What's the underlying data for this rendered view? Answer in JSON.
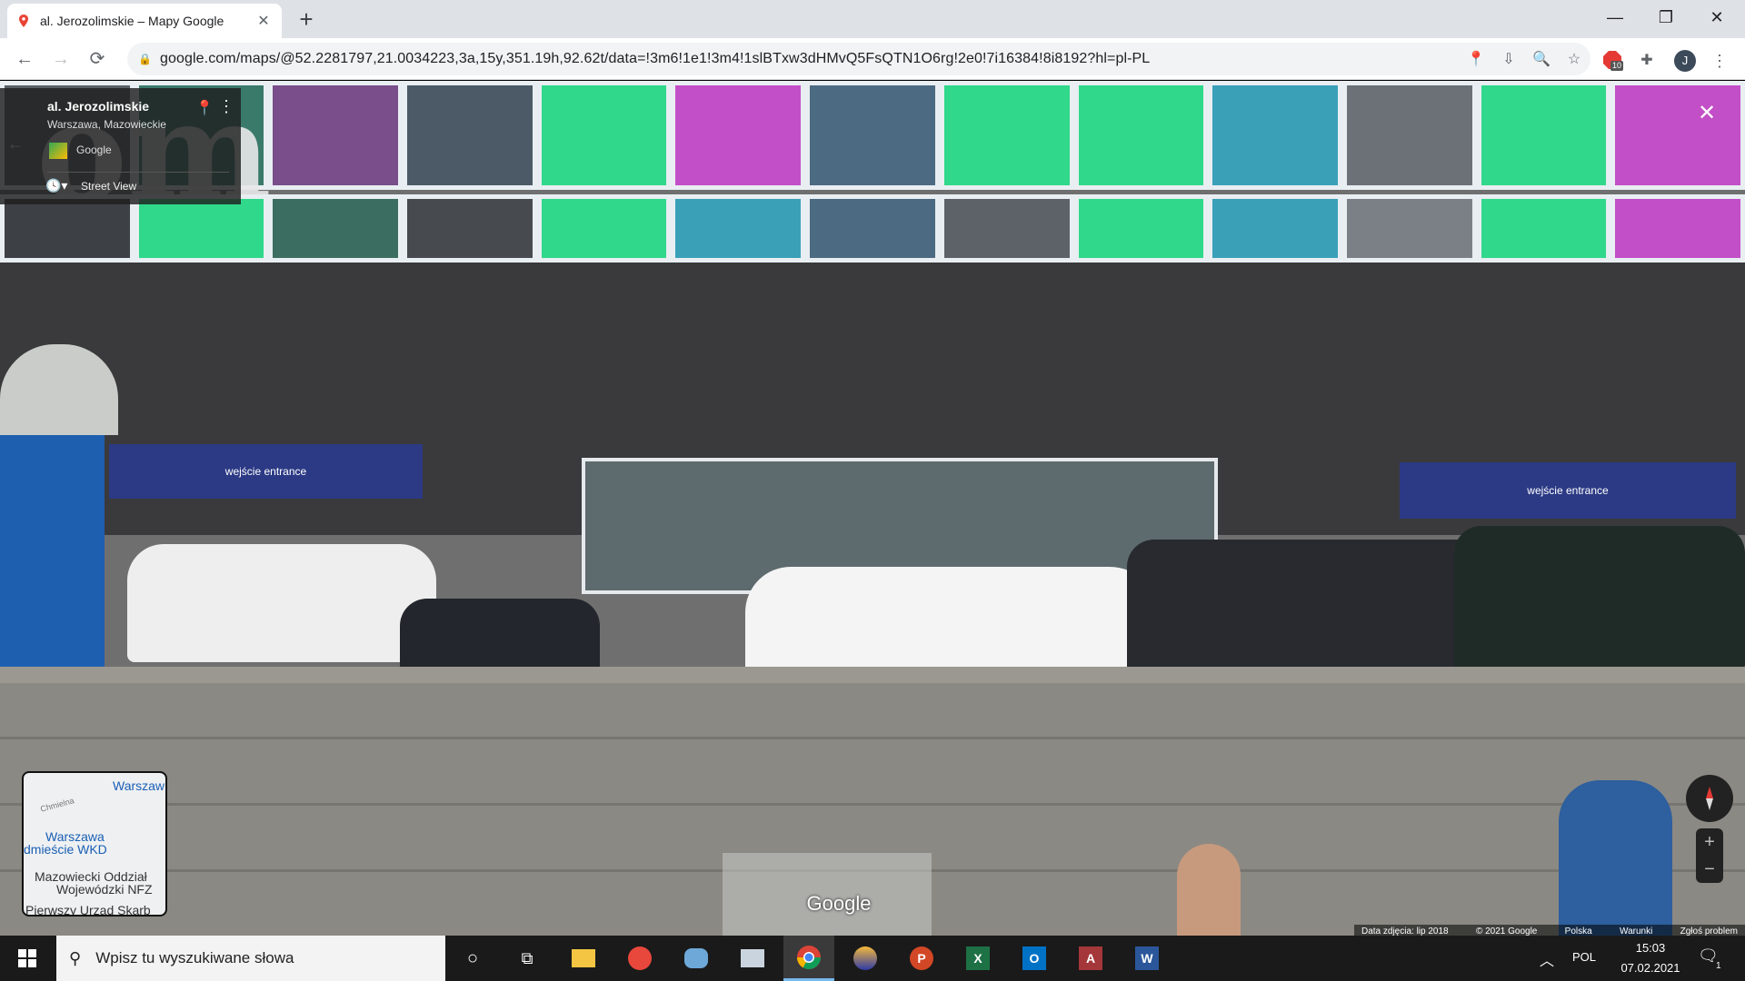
{
  "browser": {
    "tab_title": "al. Jerozolimskie – Mapy Google",
    "url": "google.com/maps/@52.2281797,21.0034223,3a,15y,351.19h,92.62t/data=!3m6!1e1!3m4!1slBTxw3dHMvQ5FsQTN1O6rg!2e0!7i16384!8i8192?hl=pl-PL",
    "ext_badge": "10",
    "profile_initial": "J"
  },
  "streetview": {
    "place_title": "al. Jerozolimskie",
    "place_subtitle": "Warszawa, Mazowieckie",
    "provider": "Google",
    "mode_label": "Street View",
    "watermark": "Google",
    "sign_left": "wejście entrance",
    "sign_right": "wejście entrance",
    "minimap_labels": [
      "Warszaw",
      "Chmielna",
      "Warszawa",
      "dmieście WKD",
      "Mazowiecki Oddział",
      "Wojewódzki NFZ",
      "Pierwszy Urząd Skarb"
    ],
    "footer": {
      "date": "Data zdjęcia: lip 2018",
      "copyright": "© 2021 Google",
      "country": "Polska",
      "terms": "Warunki",
      "report": "Zgłoś problem"
    }
  },
  "taskbar": {
    "search_placeholder": "Wpisz tu wyszukiwane słowa",
    "language": "POL",
    "time": "15:03",
    "date": "07.02.2021",
    "notifications": "1"
  },
  "colors": {
    "accent_green": "#2fd88a",
    "accent_magenta": "#c24fc7",
    "chrome_blue": "#1a73e8"
  }
}
